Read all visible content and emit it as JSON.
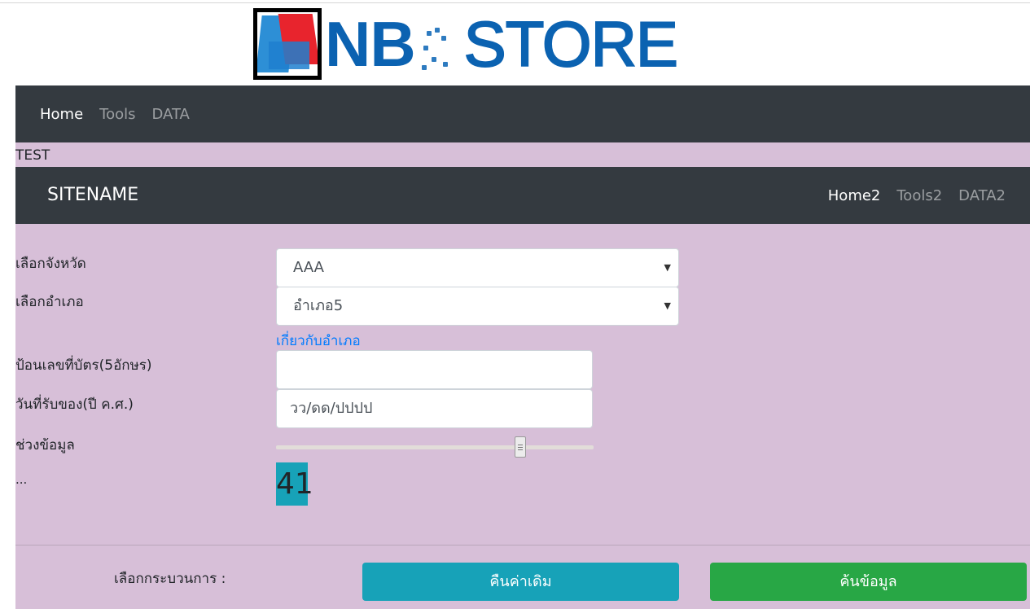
{
  "logo": {
    "text_nb": "NB",
    "text_store": "STORE"
  },
  "nav1": {
    "items": [
      "Home",
      "Tools",
      "DATA"
    ],
    "active_index": 0
  },
  "test_label": "TEST",
  "nav2": {
    "brand": "SITENAME",
    "items": [
      "Home2",
      "Tools2",
      "DATA2"
    ],
    "active_index": 0
  },
  "form": {
    "province_label": "เลือกจังหวัด",
    "province_value": "AAA",
    "district_label": "เลือกอำเภอ",
    "district_value": "อำเภอ5",
    "district_link": "เกี่ยวกับอำเภอ",
    "card_label": "ป้อนเลขที่บัตร(5อักษร)",
    "card_value": "",
    "date_label": "วันที่รับของ(ปี ค.ศ.)",
    "date_placeholder": "วว/ดด/ปปปป",
    "range_label": "ช่วงข้อมูล",
    "range_value_fraction": 0.78,
    "ellipsis": "...",
    "range_display": "41"
  },
  "actions": {
    "process_label": "เลือกกระบวนการ :",
    "reset_label": "คืนค่าเดิม",
    "search_label": "ค้นข้อมูล"
  },
  "colors": {
    "panel_bg": "#d7bfd8",
    "navbar_bg": "#343a40",
    "link": "#007bff",
    "info": "#17a2b8",
    "success": "#28a745",
    "logo_blue": "#0b62b1"
  }
}
